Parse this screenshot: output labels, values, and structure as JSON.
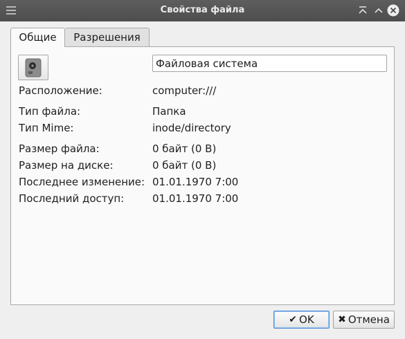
{
  "window": {
    "title": "Свойства файла"
  },
  "tabs": [
    {
      "label": "Общие",
      "active": true
    },
    {
      "label": "Разрешения",
      "active": false
    }
  ],
  "general": {
    "name_value": "Файловая система",
    "rows": [
      {
        "label": "Расположение:",
        "value": "computer:///"
      },
      {
        "label": "Тип файла:",
        "value": "Папка"
      },
      {
        "label": "Тип Mime:",
        "value": "inode/directory"
      },
      {
        "label": "Размер файла:",
        "value": "0 байт (0 B)"
      },
      {
        "label": "Размер на диске:",
        "value": "0 байт (0 B)"
      },
      {
        "label": "Последнее изменение:",
        "value": "01.01.1970 7:00"
      },
      {
        "label": "Последний доступ:",
        "value": "01.01.1970 7:00"
      }
    ],
    "icon": "drive-harddisk-icon"
  },
  "buttons": {
    "ok_label": "OK",
    "cancel_label": "Отмена"
  },
  "colors": {
    "titlebar": "#525252",
    "default_button_border": "#4a8bd6"
  }
}
